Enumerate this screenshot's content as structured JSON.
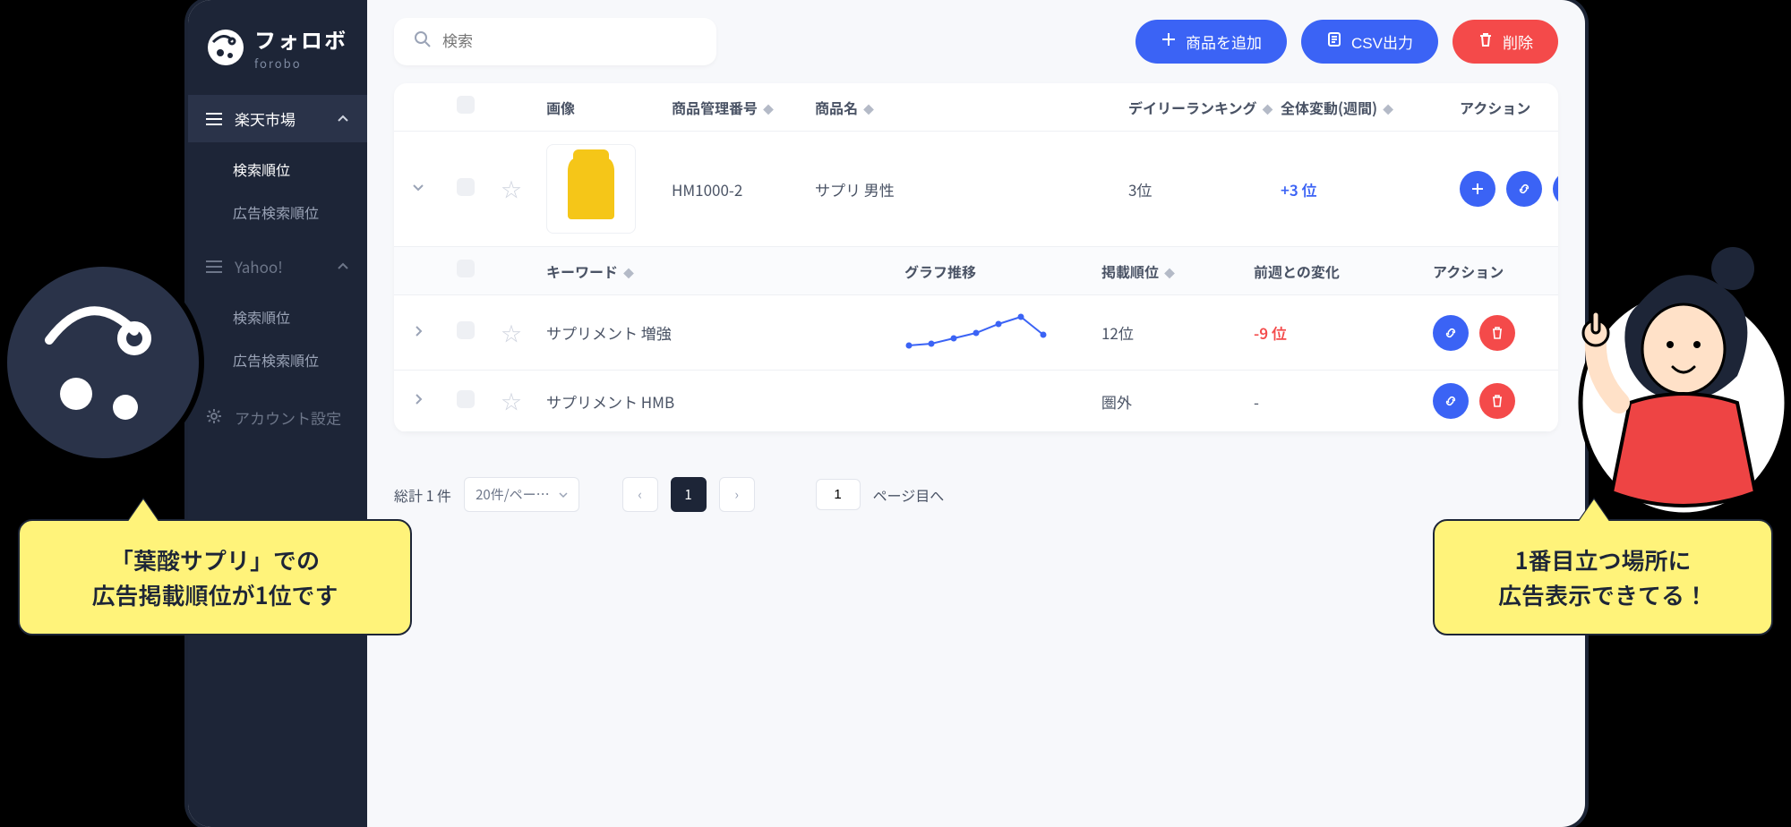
{
  "brand": {
    "name_jp": "フォロボ",
    "name_en": "forobo"
  },
  "search": {
    "placeholder": "検索"
  },
  "actions_top": {
    "add_product": "商品を追加",
    "csv_export": "CSV出力",
    "delete": "削除"
  },
  "sidebar": {
    "groups": [
      {
        "label": "楽天市場",
        "items": [
          {
            "label": "検索順位",
            "active": true
          },
          {
            "label": "広告検索順位"
          }
        ]
      },
      {
        "label": "Yahoo!",
        "items": [
          {
            "label": "検索順位"
          },
          {
            "label": "広告検索順位"
          }
        ]
      }
    ],
    "account_settings": "アカウント設定"
  },
  "table": {
    "headers": {
      "image": "画像",
      "sku": "商品管理番号",
      "name": "商品名",
      "daily_rank": "デイリーランキング",
      "weekly_change": "全体変動(週間)",
      "actions": "アクション"
    },
    "row": {
      "sku": "HM1000-2",
      "name": "サプリ 男性",
      "rank": "3位",
      "change": "+3 位"
    }
  },
  "subtable": {
    "headers": {
      "keyword": "キーワード",
      "graph": "グラフ推移",
      "rank": "掲載順位",
      "diff": "前週との変化",
      "actions": "アクション"
    },
    "rows": [
      {
        "keyword": "サプリメント 増強",
        "rank": "12位",
        "diff": "-9 位",
        "diff_class": "neg"
      },
      {
        "keyword": "サプリメント HMB",
        "rank": "圏外",
        "diff": "-",
        "diff_class": "none"
      }
    ]
  },
  "pagination": {
    "total_label": "総計 1 件",
    "per_page": "20件/ペー…",
    "page": "1",
    "goto_input": "1",
    "goto_suffix": "ページ目へ"
  },
  "callouts": {
    "left_line1": "「葉酸サプリ」での",
    "left_line2": "広告掲載順位が1位です",
    "right_line1": "1番目立つ場所に",
    "right_line2": "広告表示できてる！"
  },
  "chart_data": {
    "type": "line",
    "title": "グラフ推移",
    "x": [
      1,
      2,
      3,
      4,
      5,
      6,
      7
    ],
    "values": [
      18,
      17,
      15,
      13,
      10,
      8,
      14
    ],
    "ylim": [
      0,
      20
    ],
    "note": "lower value = higher rank; shape approximated from sparkline"
  }
}
